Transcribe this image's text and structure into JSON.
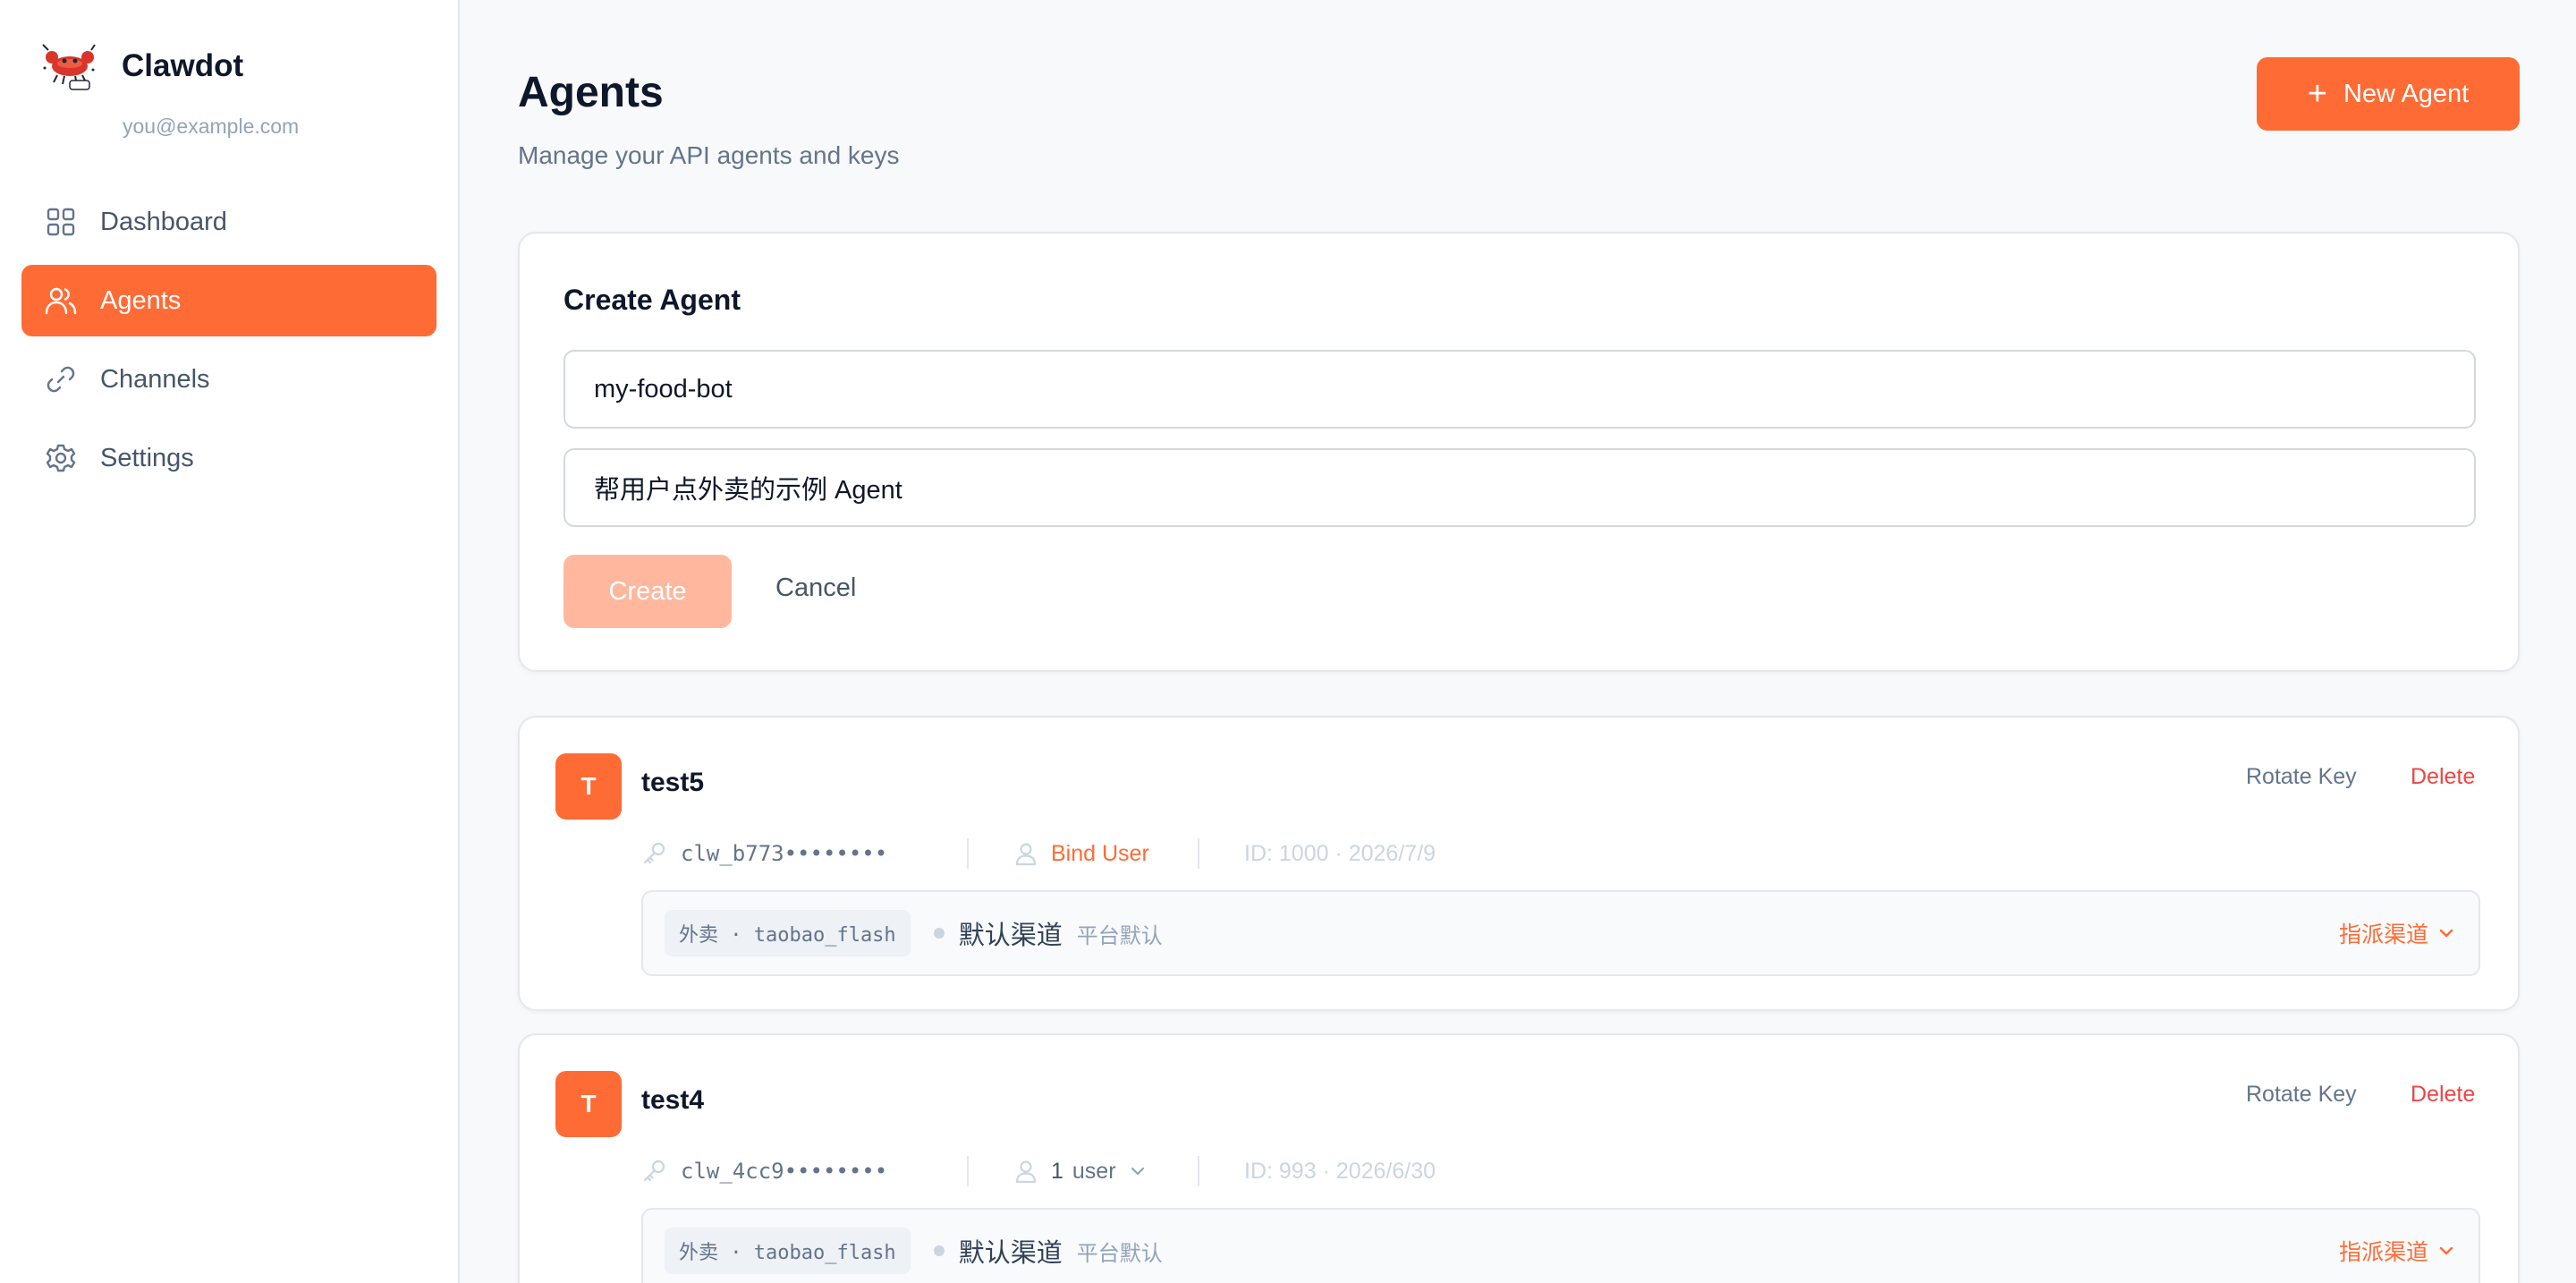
{
  "sidebar": {
    "brand_name": "Clawdot",
    "email": "you@example.com",
    "items": [
      {
        "label": "Dashboard",
        "icon": "grid-icon",
        "active": false
      },
      {
        "label": "Agents",
        "icon": "users-icon",
        "active": true
      },
      {
        "label": "Channels",
        "icon": "link-icon",
        "active": false
      },
      {
        "label": "Settings",
        "icon": "gear-icon",
        "active": false
      }
    ]
  },
  "header": {
    "title": "Agents",
    "subtitle": "Manage your API agents and keys",
    "new_agent_label": "New Agent"
  },
  "create_form": {
    "title": "Create Agent",
    "name_value": "my-food-bot",
    "description_value": "帮用户点外卖的示例 Agent",
    "create_label": "Create",
    "cancel_label": "Cancel"
  },
  "agents": [
    {
      "avatar_letter": "T",
      "name": "test5",
      "key": "clw_b773••••••••",
      "user_action": "Bind User",
      "id_date": "ID: 1000 · 2026/7/9",
      "channel_tag": "外卖 · taobao_flash",
      "channel_name": "默认渠道",
      "channel_sub": "平台默认",
      "assign_label": "指派渠道",
      "rotate_label": "Rotate Key",
      "delete_label": "Delete"
    },
    {
      "avatar_letter": "T",
      "name": "test4",
      "key": "clw_4cc9••••••••",
      "user_count": "1",
      "user_unit": "user",
      "id_date": "ID: 993 · 2026/6/30",
      "channel_tag": "外卖 · taobao_flash",
      "channel_name": "默认渠道",
      "channel_sub": "平台默认",
      "assign_label": "指派渠道",
      "rotate_label": "Rotate Key",
      "delete_label": "Delete"
    }
  ],
  "colors": {
    "accent": "#ff6b35",
    "accent_disabled": "#ffb89d",
    "danger": "#ef4444"
  }
}
